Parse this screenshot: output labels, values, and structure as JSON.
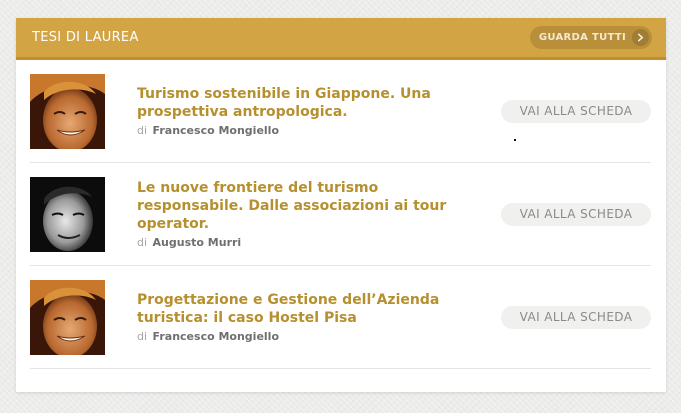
{
  "header": {
    "title": "TESI DI LAUREA",
    "see_all_label": "GUARDA TUTTI",
    "see_all_icon": "chevron-right-icon"
  },
  "colors": {
    "accent": "#d2a443",
    "title_text": "#b6902f",
    "button_bg": "#f0f0ef"
  },
  "theses": [
    {
      "title": "Turismo sostenibile in Giappone. Una prospettiva antropologica.",
      "by": "di",
      "author": "Francesco Mongiello",
      "button": "VAI ALLA SCHEDA",
      "avatar": "color"
    },
    {
      "title": "Le nuove frontiere del turismo responsabile. Dalle associazioni ai tour operator.",
      "by": "di",
      "author": "Augusto Murri",
      "button": "VAI ALLA SCHEDA",
      "avatar": "bw"
    },
    {
      "title": "Progettazione e Gestione dell’Azienda turistica: il caso Hostel Pisa",
      "by": "di",
      "author": "Francesco Mongiello",
      "button": "VAI ALLA SCHEDA",
      "avatar": "color"
    }
  ]
}
